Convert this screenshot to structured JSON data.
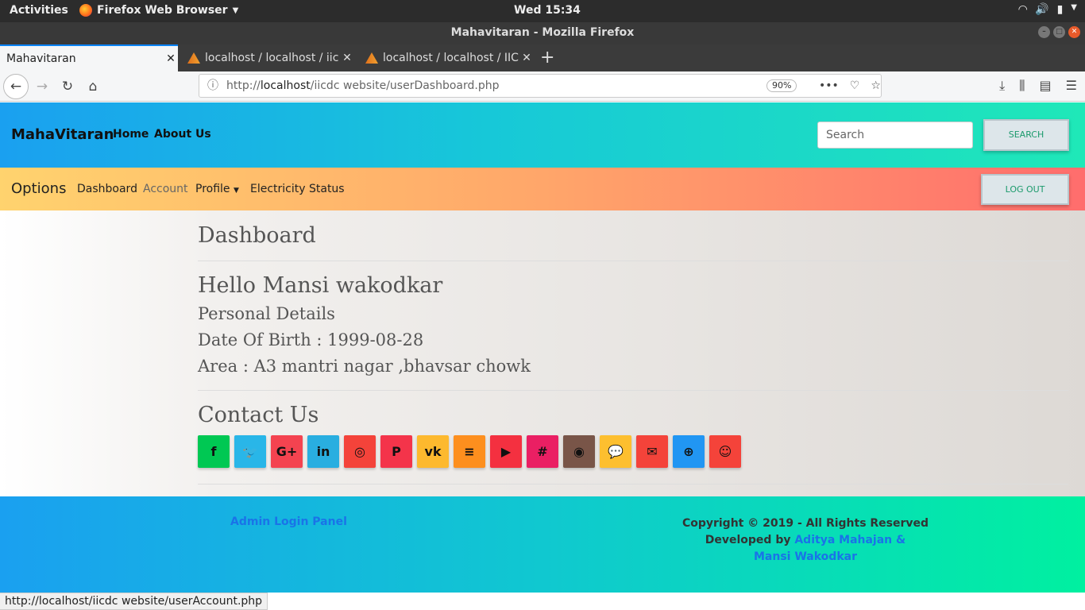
{
  "os": {
    "activities": "Activities",
    "app_name": "Firefox Web Browser",
    "clock": "Wed 15:34"
  },
  "window": {
    "title": "Mahavitaran - Mozilla Firefox"
  },
  "tabs": [
    {
      "label": "Mahavitaran"
    },
    {
      "label": "localhost / localhost / iic"
    },
    {
      "label": "localhost / localhost / IIC"
    }
  ],
  "url": {
    "prefix": "http://",
    "host": "localhost",
    "path": "/iicdc website/userDashboard.php",
    "zoom": "90%"
  },
  "header": {
    "brand": "MahaVitaran",
    "nav": [
      "Home",
      "About Us"
    ],
    "search_placeholder": "Search",
    "search_button": "SEARCH"
  },
  "optionsbar": {
    "brand": "Options",
    "items": [
      "Dashboard",
      "Account",
      "Profile",
      "Electricity Status"
    ],
    "logout": "LOG OUT"
  },
  "main": {
    "title": "Dashboard",
    "greeting": "Hello Mansi wakodkar",
    "personal_details": "Personal Details",
    "dob": "Date Of Birth : 1999-08-28",
    "area": "Area : A3 mantri nagar ,bhavsar chowk",
    "contact_title": "Contact Us"
  },
  "socials": [
    {
      "name": "facebook",
      "glyph": "f",
      "color": "#00c853"
    },
    {
      "name": "twitter",
      "glyph": "🐦",
      "color": "#29b6e8"
    },
    {
      "name": "google-plus",
      "glyph": "G+",
      "color": "#f44350"
    },
    {
      "name": "linkedin",
      "glyph": "in",
      "color": "#29aee0"
    },
    {
      "name": "instagram",
      "glyph": "◎",
      "color": "#f4433a"
    },
    {
      "name": "pinterest",
      "glyph": "P",
      "color": "#f4344a"
    },
    {
      "name": "vk",
      "glyph": "vk",
      "color": "#fdb92e"
    },
    {
      "name": "stack-overflow",
      "glyph": "≡",
      "color": "#fd8f1e"
    },
    {
      "name": "youtube",
      "glyph": "▶",
      "color": "#f43040"
    },
    {
      "name": "slack",
      "glyph": "#",
      "color": "#ea1f63"
    },
    {
      "name": "github",
      "glyph": "◉",
      "color": "#795548"
    },
    {
      "name": "comments",
      "glyph": "💬",
      "color": "#fdbf2f"
    },
    {
      "name": "email",
      "glyph": "✉",
      "color": "#f4433a"
    },
    {
      "name": "dribbble",
      "glyph": "⊕",
      "color": "#2196f3"
    },
    {
      "name": "reddit",
      "glyph": "☺",
      "color": "#f4433a"
    }
  ],
  "footer": {
    "admin_link": "Admin Login Panel",
    "copyright": "Copyright © 2019 - All Rights Reserved",
    "developed_by": "Developed by ",
    "dev1": "Aditya Mahajan &",
    "dev2": "Mansi Wakodkar"
  },
  "statusbar": "http://localhost/iicdc website/userAccount.php"
}
